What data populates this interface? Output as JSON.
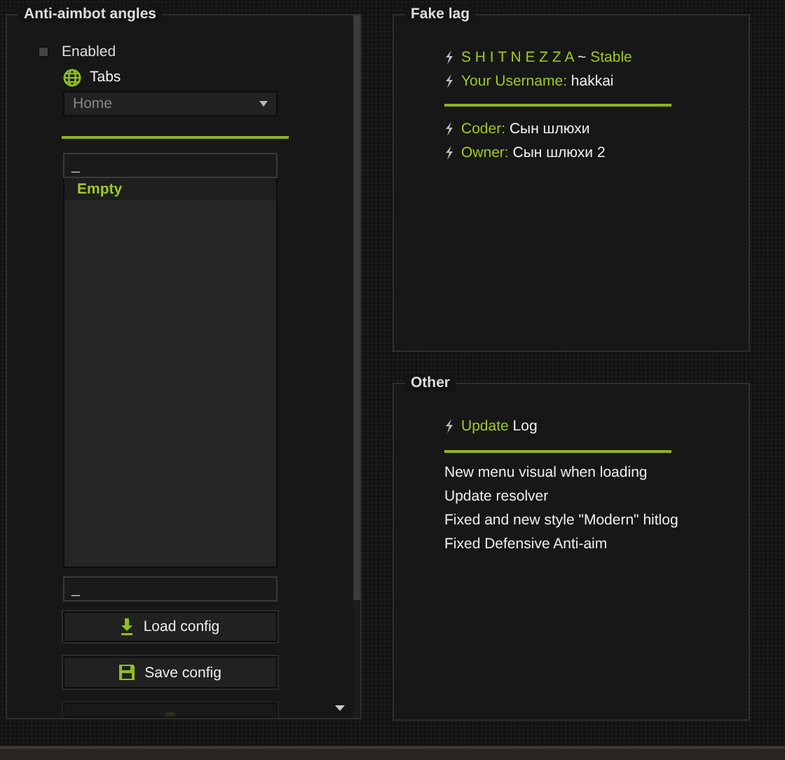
{
  "left": {
    "title": "Anti-aimbot angles",
    "enabled": {
      "label": "Enabled",
      "checked": false
    },
    "tabs": {
      "label": "Tabs",
      "value": "Home"
    },
    "list": {
      "search": "_",
      "items": [
        {
          "label": "Empty",
          "selected": true
        }
      ]
    },
    "name_field": "_",
    "buttons": [
      {
        "kind": "load",
        "label": "Load config",
        "disabled": false
      },
      {
        "kind": "save",
        "label": "Save config",
        "disabled": false
      },
      {
        "kind": "cut",
        "disabled": true
      }
    ]
  },
  "fake_lag": {
    "title": "Fake lag",
    "groups": [
      [
        [
          {
            "text": "S H I T N E Z Z A",
            "accent": true
          },
          {
            "text": " ~ ",
            "accent": false
          },
          {
            "text": "Stable",
            "accent": true
          }
        ],
        [
          {
            "text": "Your Username: ",
            "accent": true
          },
          {
            "text": "hakkai",
            "accent": false
          }
        ]
      ],
      [
        [
          {
            "text": "Coder: ",
            "accent": true
          },
          {
            "text": "Сын шлюхи",
            "accent": false
          }
        ],
        [
          {
            "text": "Owner: ",
            "accent": true
          },
          {
            "text": "Сын шлюхи 2",
            "accent": false
          }
        ]
      ]
    ]
  },
  "other": {
    "title": "Other",
    "header": [
      {
        "text": "Update",
        "accent": true
      },
      {
        "text": " Log",
        "accent": false
      }
    ],
    "log": [
      "New menu visual when loading",
      "Update resolver",
      "Fixed and new style \"Modern\" hitlog",
      "Fixed Defensive Anti-aim"
    ]
  }
}
